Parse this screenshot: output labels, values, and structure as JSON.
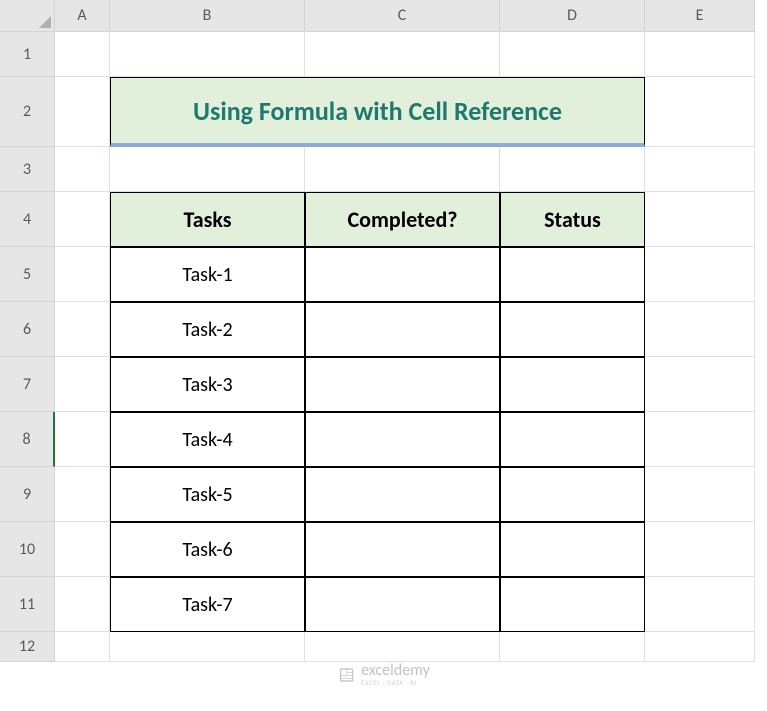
{
  "columns": [
    "A",
    "B",
    "C",
    "D",
    "E"
  ],
  "rows": [
    "1",
    "2",
    "3",
    "4",
    "5",
    "6",
    "7",
    "8",
    "9",
    "10",
    "11",
    "12"
  ],
  "title": "Using Formula with Cell Reference",
  "table": {
    "headers": {
      "tasks": "Tasks",
      "completed": "Completed?",
      "status": "Status"
    },
    "data": [
      {
        "task": "Task-1",
        "completed": "",
        "status": ""
      },
      {
        "task": "Task-2",
        "completed": "",
        "status": ""
      },
      {
        "task": "Task-3",
        "completed": "",
        "status": ""
      },
      {
        "task": "Task-4",
        "completed": "",
        "status": ""
      },
      {
        "task": "Task-5",
        "completed": "",
        "status": ""
      },
      {
        "task": "Task-6",
        "completed": "",
        "status": ""
      },
      {
        "task": "Task-7",
        "completed": "",
        "status": ""
      }
    ]
  },
  "selected_row": "8",
  "watermark": {
    "text": "exceldemy",
    "subtext": "EXCEL · DATA · BI"
  }
}
